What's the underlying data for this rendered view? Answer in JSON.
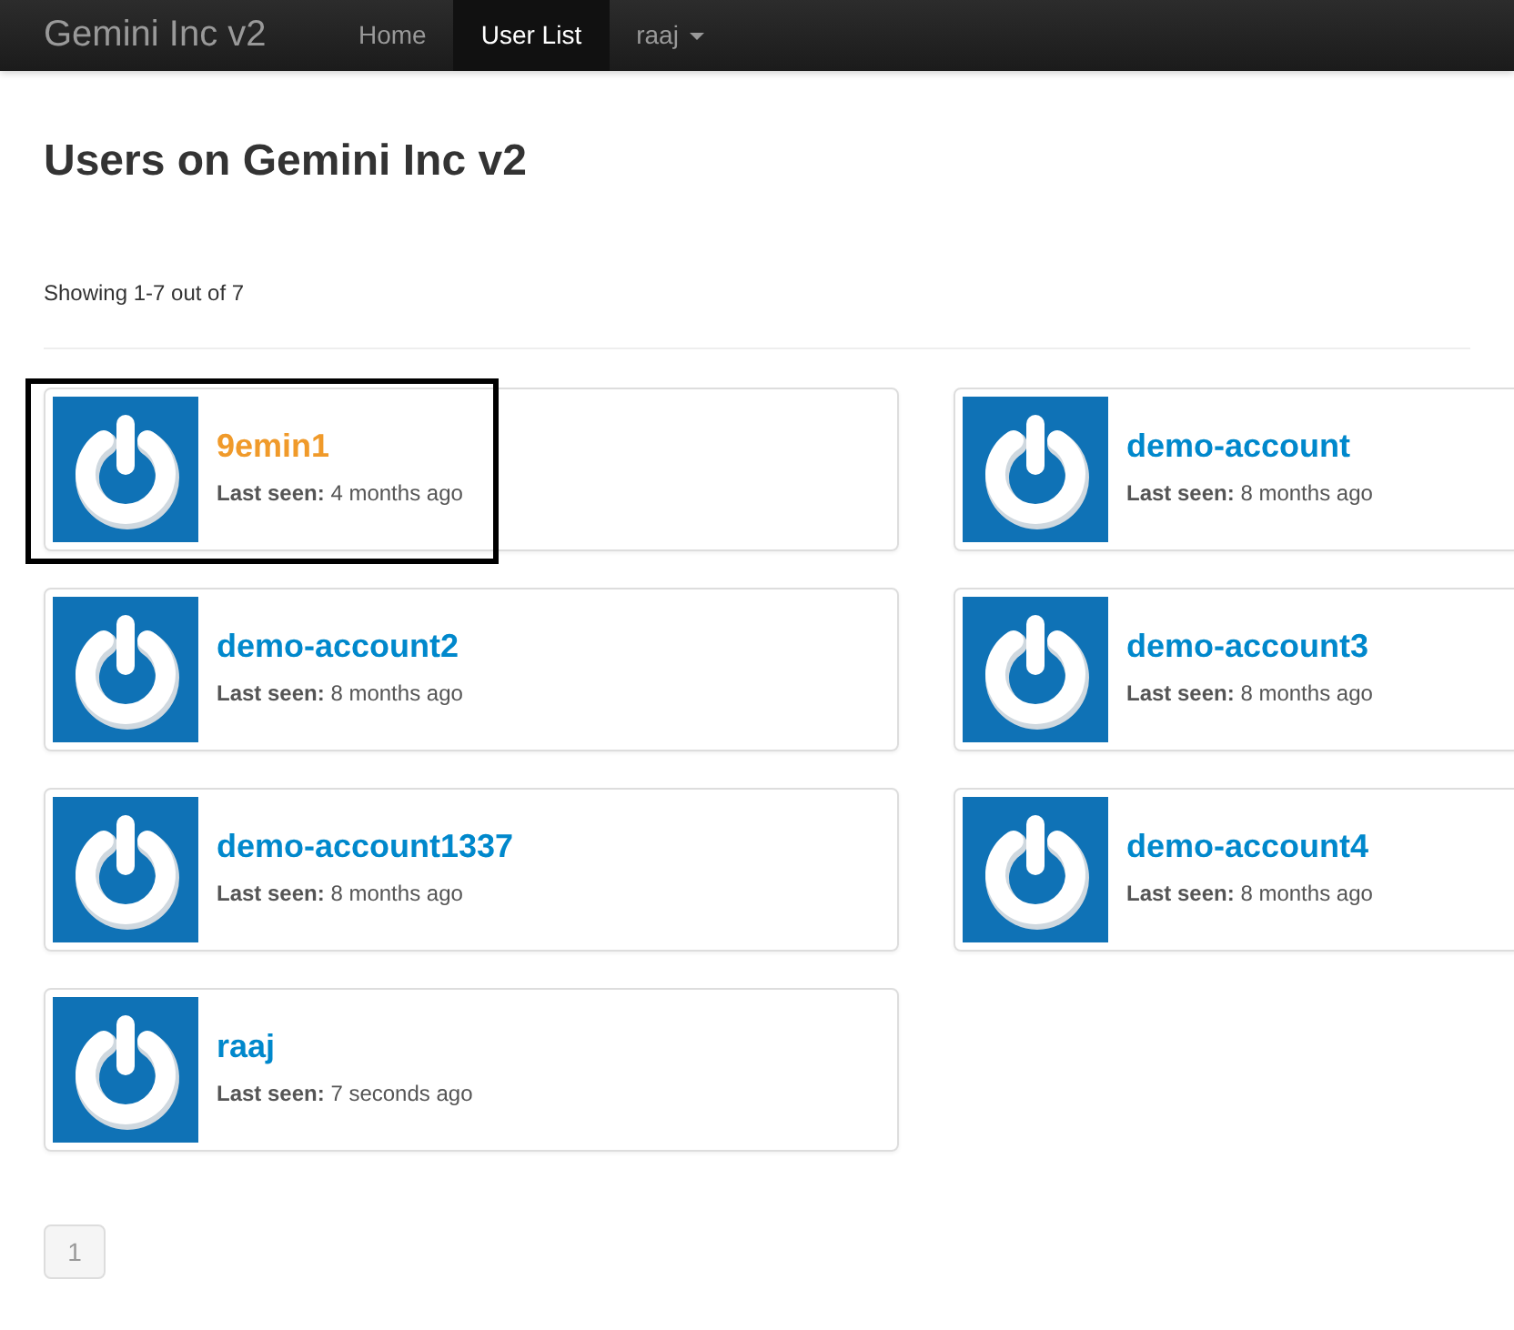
{
  "navbar": {
    "brand": "Gemini Inc v2",
    "items": [
      {
        "label": "Home",
        "selected": false,
        "dropdown": false
      },
      {
        "label": "User List",
        "selected": true,
        "dropdown": false
      },
      {
        "label": "raaj",
        "selected": false,
        "dropdown": true
      }
    ]
  },
  "heading": "Users on Gemini Inc v2",
  "summary": "Showing 1-7 out of 7",
  "users": [
    {
      "name": "9emin1",
      "last_seen_label": "Last seen:",
      "last_seen": "4 months ago",
      "highlighted": true
    },
    {
      "name": "demo-account",
      "last_seen_label": "Last seen:",
      "last_seen": "8 months ago",
      "highlighted": false
    },
    {
      "name": "demo-account2",
      "last_seen_label": "Last seen:",
      "last_seen": "8 months ago",
      "highlighted": false
    },
    {
      "name": "demo-account3",
      "last_seen_label": "Last seen:",
      "last_seen": "8 months ago",
      "highlighted": false
    },
    {
      "name": "demo-account1337",
      "last_seen_label": "Last seen:",
      "last_seen": "8 months ago",
      "highlighted": false
    },
    {
      "name": "demo-account4",
      "last_seen_label": "Last seen:",
      "last_seen": "8 months ago",
      "highlighted": false
    },
    {
      "name": "raaj",
      "last_seen_label": "Last seen:",
      "last_seen": "7 seconds ago",
      "highlighted": false
    }
  ],
  "pagination": [
    {
      "label": "1",
      "selected": true
    }
  ]
}
